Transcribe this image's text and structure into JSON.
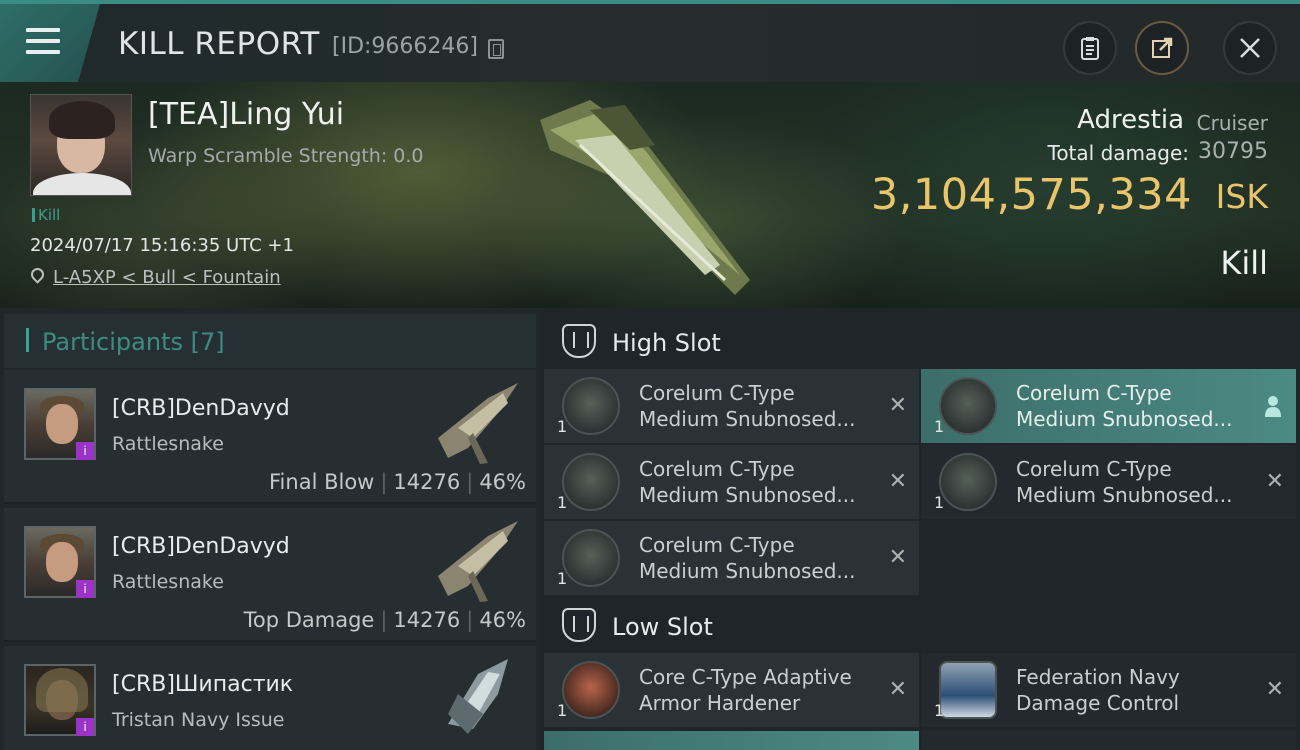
{
  "header": {
    "title": "KILL REPORT",
    "report_id": "[ID:9666246]"
  },
  "victim": {
    "name": "[TEA]Ling Yui",
    "warp_scramble": "Warp Scramble Strength: 0.0",
    "tag": "Kill",
    "timestamp": "2024/07/17 15:16:35 UTC +1",
    "location": "L-A5XP < Bull < Fountain"
  },
  "ship": {
    "name": "Adrestia",
    "class": "Cruiser",
    "total_damage_label": "Total damage:",
    "total_damage": "30795",
    "isk_value": "3,104,575,334",
    "isk_unit": "ISK",
    "kill_type": "Kill"
  },
  "participants": {
    "header": "Participants [7]",
    "items": [
      {
        "name": "[CRB]DenDavyd",
        "ship": "Rattlesnake",
        "role": "Final Blow",
        "damage": "14276",
        "percent": "46%"
      },
      {
        "name": "[CRB]DenDavyd",
        "ship": "Rattlesnake",
        "role": "Top Damage",
        "damage": "14276",
        "percent": "46%"
      },
      {
        "name": "[CRB]Шипастик",
        "ship": "Tristan Navy Issue",
        "role": "",
        "damage": "",
        "percent": ""
      }
    ]
  },
  "fitting": {
    "high_slot_label": "High Slot",
    "low_slot_label": "Low Slot",
    "high": [
      {
        "line1": "Corelum C-Type",
        "line2": "Medium Snubnosed...",
        "qty": "1",
        "status": "destroyed"
      },
      {
        "line1": "Corelum C-Type",
        "line2": "Medium Snubnosed...",
        "qty": "1",
        "status": "dropped"
      },
      {
        "line1": "Corelum C-Type",
        "line2": "Medium Snubnosed...",
        "qty": "1",
        "status": "destroyed"
      },
      {
        "line1": "Corelum C-Type",
        "line2": "Medium Snubnosed...",
        "qty": "1",
        "status": "destroyed"
      },
      {
        "line1": "Corelum C-Type",
        "line2": "Medium Snubnosed...",
        "qty": "1",
        "status": "destroyed"
      }
    ],
    "low": [
      {
        "line1": "Core C-Type Adaptive",
        "line2": "Armor Hardener",
        "qty": "1",
        "status": "destroyed"
      },
      {
        "line1": "Federation Navy",
        "line2": "Damage Control",
        "qty": "1",
        "status": "destroyed"
      }
    ]
  },
  "colors": {
    "accent": "#3aa495",
    "isk": "#e8c46a",
    "highlight": "#4c8a84"
  }
}
